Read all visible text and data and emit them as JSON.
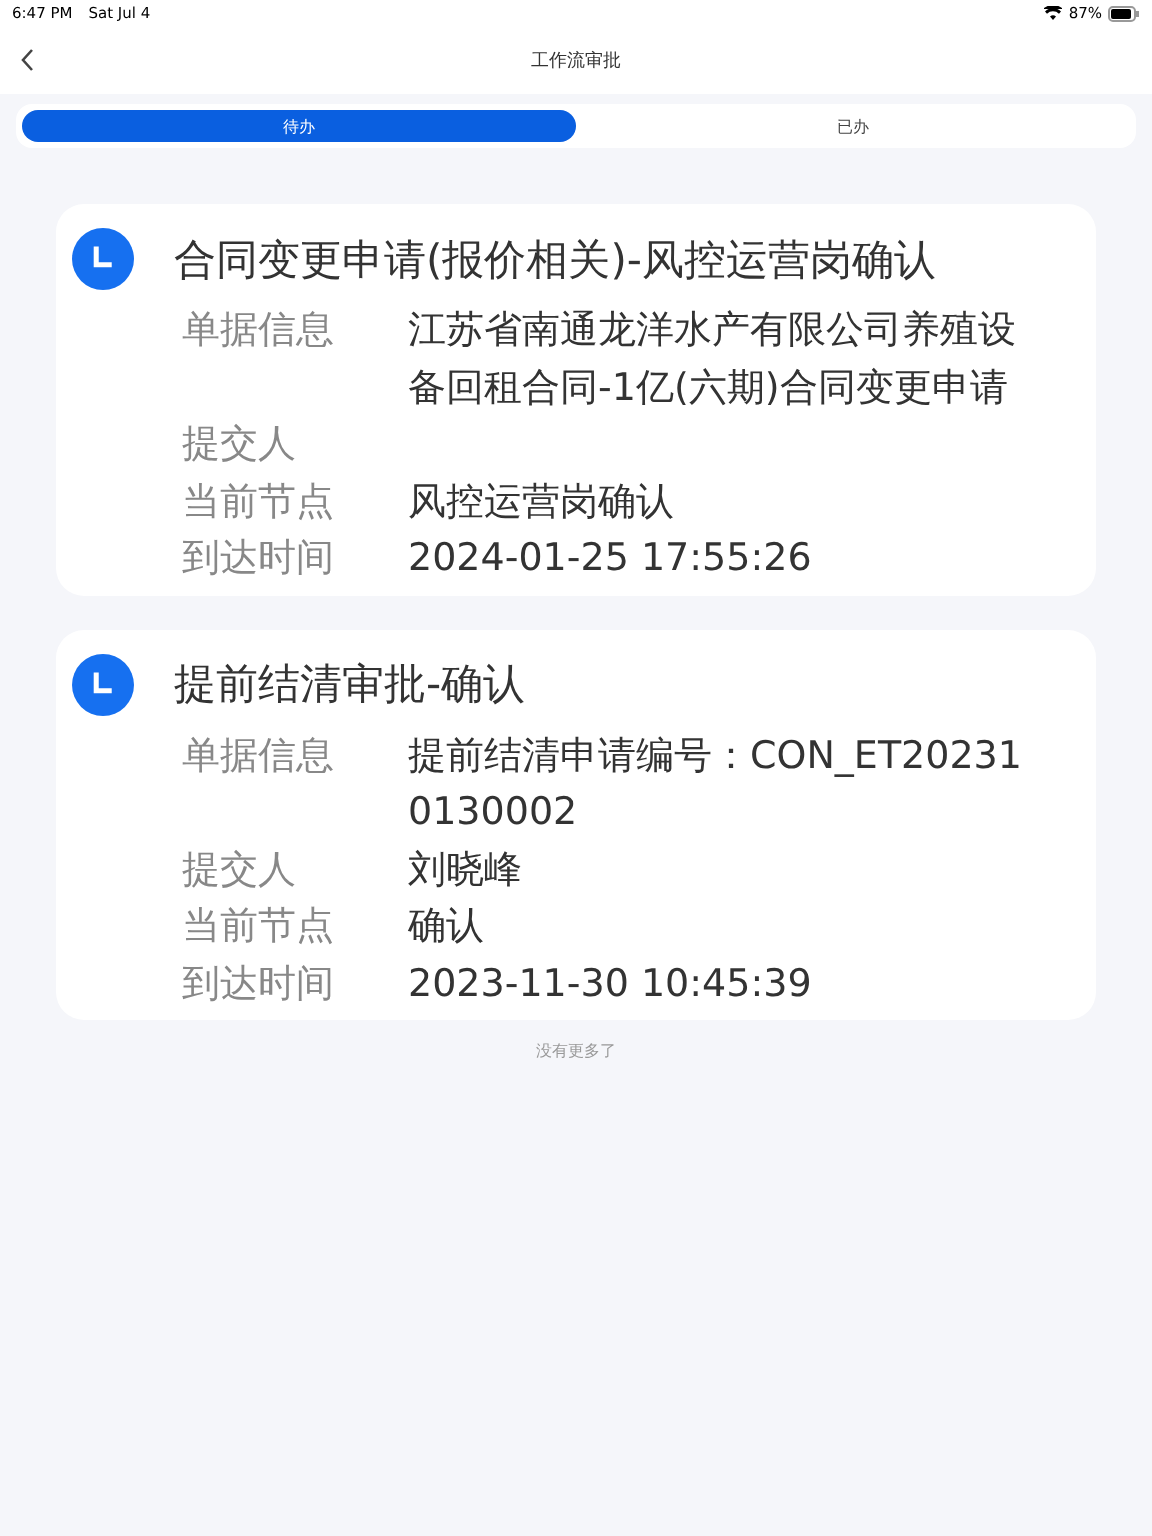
{
  "status_bar": {
    "time": "6:47 PM",
    "date": "Sat Jul 4",
    "battery": "87%"
  },
  "header": {
    "title": "工作流审批"
  },
  "tabs": [
    {
      "label": "待办",
      "selected": true
    },
    {
      "label": "已办",
      "selected": false
    }
  ],
  "cards": [
    {
      "title": "合同变更申请(报价相关)-风控运营岗确认",
      "fields": [
        {
          "label": "单据信息",
          "value": "江苏省南通龙洋水产有限公司养殖设备回租合同-1亿(六期)合同变更申请"
        },
        {
          "label": "提交人"
        },
        {
          "label": "当前节点",
          "value": "风控运营岗确认"
        },
        {
          "label": "到达时间",
          "value": "2024-01-25 17:55:26"
        }
      ]
    },
    {
      "title": "提前结清审批-确认",
      "fields": [
        {
          "label": "单据信息",
          "value": "提前结清申请编号：CON_ET202310130002"
        },
        {
          "label": "提交人",
          "value": "刘晓峰"
        },
        {
          "label": "当前节点",
          "value": "确认"
        },
        {
          "label": "到达时间",
          "value": "2023-11-30 10:45:39"
        }
      ]
    }
  ],
  "footer": "没有更多了"
}
